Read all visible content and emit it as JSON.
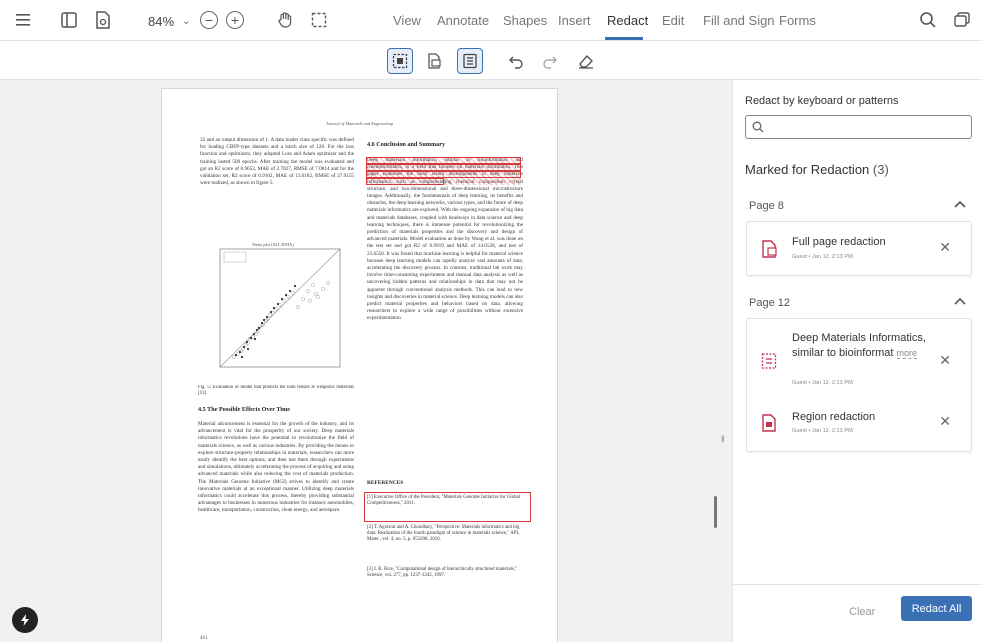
{
  "toolbar": {
    "zoom_value": "84%",
    "nav_tabs": [
      "View",
      "Annotate",
      "Shapes",
      "Insert",
      "Redact",
      "Edit",
      "Fill and Sign",
      "Forms"
    ],
    "active_tab": "Redact",
    "accent_color": "#3b6fb6",
    "redact_color": "#d23c3c"
  },
  "document": {
    "running_header": "Journal of Materials and Engineering",
    "left_column_intro": "32 and an output dimension of 1. A data loader class specific was defined for loading CBFP-type datasets and a batch size of 128. For the loss function and optimizers, they adopted Loss and Adam optimizer and the training lasted 500 epochs. After training the model was evaluated and got an R2 score of 0.9653, MAE of 2.7827, RMSE of 7.0814 and for the validation set, R2 score of 0.9102, MAE of 13.6182, RMSE of 27.9155 were realized, as shown in figure 5.",
    "chart_title": "Parity plot (ALL DATA)",
    "figure_caption": "Fig. 5: Evaluation of model that predicts the bulk tensile at weaponic materials [13].",
    "section_45_title": "4.5 The Possible Effects Over Time",
    "section_45_text": "Material advancement is essential for the growth of the industry, and its advancement is vital for the prosperity of our society. Deep materials informatics revolutions have the potential to revolutionize the field of materials science, as well as various industries. By providing the means to explore structure-property relationships in materials, researchers can more easily identify the best options, and then test them through experiments and simulations, ultimately accelerating the process of acquiring and using advanced materials while also reducing the cost of materials production. The Materials Genome Initiative (MGI) strives to identify and create innovative materials at an exceptional manner. Utilizing deep materials informatics could accelerate this process, thereby providing substantial advantages to businesses in numerous industries for instance automobiles, healthcare, transportation, construction, clean energy, and aerospace.",
    "section_46_title": "4.6 Conclusion and Summary",
    "section_46_text": "Deep Materials Informatics, similar to bioinformatics and cheminformatics, is a field that focuses on materials informatics. This paper examines the most recent developments in deep materials informatics, such as comprehending chemical composition crystal structure, and two-dimensional and three-dimensional microstructure images. Additionally, the fundamentals of deep learning, its benefits and obstacles, the deep learning networks, various types, and the future of deep materials informatics are explored. With the ongoing expansion of big data and materials databases, coupled with headways in data science and deep learning techniques, there is immense potential for revolutionizing the prediction of materials properties and the discovery and design of advanced materials. Model evaluation as done by Wang et al. was done on the test set and got R2 of 0.9919 and MAE of 14.6528, and test of 23.6550. It was found that machine learning is helpful for material science because deep learning models can rapidly analyze vast amounts of data, accelerating the discovery process. In contrast, traditional lab work may involve time-consuming experiments and manual data analysis as well as uncovering hidden patterns and relationships in data that may not be apparent through conventional analysis methods. This can lead to new insights and discoveries in material science. Deep learning models can also predict material properties and behaviors based on data, allowing researchers to explore a wide range of possibilities without extensive experimentation.",
    "references_title": "REFERENCES",
    "references": [
      "[1]  Executive Office of the President, \"Materials Genome Initiative for Global Competitiveness,\" 2011.",
      "[2]  T. Agrawal and A. Choudhary, \"Perspective: Materials informatics and big data: Realization of the fourth paradigm of science in materials science,\" APL Mater., vol. 4, no. 5, p. 053208, 2016.",
      "[3]  J. R. Rice, \"Computational design of hierarchically structured materials,\" Science, vol. 277, pp. 1237-1242, 1997."
    ],
    "page_number": "461"
  },
  "panel": {
    "search_label": "Redact by keyboard or patterns",
    "search_placeholder": "",
    "marked_title": "Marked for Redaction",
    "marked_count": "(3)",
    "groups": [
      {
        "page_label": "Page 8",
        "items": [
          {
            "type": "page",
            "title": "Full page redaction",
            "meta": "Guest • Jan 12, 2:13 PM"
          }
        ]
      },
      {
        "page_label": "Page 12",
        "items": [
          {
            "type": "text",
            "title": "Deep Materials Informatics, similar to bioinformat",
            "more_label": "more",
            "meta": "Guest • Jan 12, 2:13 PM"
          },
          {
            "type": "region",
            "title": "Region redaction",
            "meta": "Guest • Jan 12, 2:13 PM"
          }
        ]
      }
    ],
    "clear_label": "Clear",
    "redact_all_label": "Redact All"
  }
}
